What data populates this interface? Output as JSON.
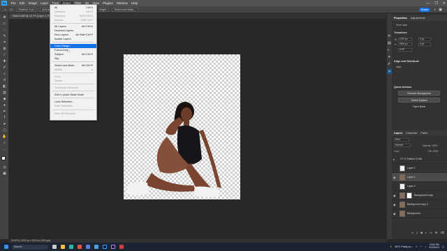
{
  "menubar": {
    "logo": "Ps",
    "items": [
      "File",
      "Edit",
      "Image",
      "Layer",
      "Type",
      "Select",
      "Filter",
      "3D",
      "View",
      "Plugins",
      "Window",
      "Help"
    ],
    "active": "Select",
    "window_controls": [
      "—",
      "❐",
      "✕"
    ]
  },
  "options": {
    "items": [
      "Feather: 0 px",
      "Anti-alias",
      "Style: Normal",
      "Width",
      "Height",
      "Select and Mask..."
    ],
    "share_label": "Share",
    "share_color": "#1473e6"
  },
  "document": {
    "tab_title": "7066V11587@ 16.7% (Layer 1, RGB/8#) *",
    "status": "16.67%  |  3000 px x 3000 px (300 ppi)"
  },
  "select_menu": {
    "items": [
      {
        "label": "All",
        "shortcut": "Ctrl+A",
        "disabled": false,
        "highlight": false
      },
      {
        "label": "Deselect",
        "shortcut": "Ctrl+D",
        "disabled": true,
        "highlight": false
      },
      {
        "label": "Reselect",
        "shortcut": "Shift+Ctrl+D",
        "disabled": true,
        "highlight": false
      },
      {
        "label": "Inverse",
        "shortcut": "Shift+Ctrl+I",
        "disabled": true,
        "highlight": false
      },
      {
        "sep": true
      },
      {
        "label": "All Layers",
        "shortcut": "Alt+Ctrl+A",
        "disabled": false,
        "highlight": false
      },
      {
        "label": "Deselect Layers",
        "shortcut": "",
        "disabled": false,
        "highlight": false
      },
      {
        "label": "Find Layers",
        "shortcut": "Alt+Shift+Ctrl+F",
        "disabled": false,
        "highlight": false
      },
      {
        "label": "Isolate Layers",
        "shortcut": "",
        "disabled": false,
        "highlight": false
      },
      {
        "sep": true
      },
      {
        "label": "Color Range...",
        "shortcut": "",
        "disabled": false,
        "highlight": true
      },
      {
        "label": "Focus Area...",
        "shortcut": "",
        "disabled": false,
        "highlight": false
      },
      {
        "label": "Subject",
        "shortcut": "Alt+Ctrl+S",
        "disabled": false,
        "highlight": false
      },
      {
        "label": "Sky",
        "shortcut": "",
        "disabled": false,
        "highlight": false
      },
      {
        "sep": true
      },
      {
        "label": "Select and Mask...",
        "shortcut": "Alt+Ctrl+R",
        "disabled": false,
        "highlight": false
      },
      {
        "label": "Modify",
        "shortcut": "▸",
        "disabled": true,
        "highlight": false
      },
      {
        "sep": true
      },
      {
        "label": "Grow",
        "shortcut": "",
        "disabled": true,
        "highlight": false
      },
      {
        "label": "Similar",
        "shortcut": "",
        "disabled": true,
        "highlight": false
      },
      {
        "sep": true
      },
      {
        "label": "Transform Selection",
        "shortcut": "",
        "disabled": true,
        "highlight": false
      },
      {
        "sep": true
      },
      {
        "label": "Edit in Quick Mask Mode",
        "shortcut": "",
        "disabled": false,
        "highlight": false
      },
      {
        "sep": true
      },
      {
        "label": "Load Selection...",
        "shortcut": "",
        "disabled": false,
        "highlight": false
      },
      {
        "label": "Save Selection...",
        "shortcut": "",
        "disabled": true,
        "highlight": false
      },
      {
        "sep": true
      },
      {
        "label": "New 3D Extrusion",
        "shortcut": "",
        "disabled": true,
        "highlight": false
      }
    ]
  },
  "properties": {
    "tabs": [
      "Properties",
      "Adjustments"
    ],
    "layer_kind": "Pixel Layer",
    "transform_header": "Transform",
    "w_value": "2767 px",
    "h_value": "3000 px",
    "x_value": "0 px",
    "y_value": "0 px",
    "angle_value": "0.00°",
    "align_header": "Align and Distribute",
    "align_label": "Align:",
    "quick_actions_header": "Quick Actions",
    "buttons": [
      "Remove Background",
      "Select Subject",
      "Open More"
    ]
  },
  "layers_panel": {
    "tabs": [
      "Layers",
      "Channels",
      "Paths"
    ],
    "filter_kind": "Kind",
    "blend_mode": "Normal",
    "opacity": "Opacity: 100%",
    "lock_label": "Lock:",
    "fill": "Fill: 100%",
    "layers": [
      {
        "name": "2 F G Pattern Gi Me",
        "type": "group",
        "visible": false,
        "selected": false,
        "mask": false
      },
      {
        "name": "Layer 1",
        "type": "pixel",
        "visible": false,
        "selected": false,
        "mask": false
      },
      {
        "name": "Layer 1",
        "type": "photo",
        "visible": true,
        "selected": true,
        "mask": false
      },
      {
        "name": "Layer 2",
        "type": "pixel",
        "visible": false,
        "selected": false,
        "mask": false
      },
      {
        "name": "Background copy",
        "type": "photo",
        "visible": true,
        "selected": false,
        "mask": true
      },
      {
        "name": "Background copy 2",
        "type": "photo",
        "visible": true,
        "selected": false,
        "mask": false
      },
      {
        "name": "Background",
        "type": "photo",
        "visible": true,
        "selected": false,
        "mask": false
      }
    ]
  },
  "taskbar": {
    "search_placeholder": "Search",
    "weather": "28°C  Partly su...",
    "time": "10:52 PM",
    "date": "9/20/2023"
  }
}
